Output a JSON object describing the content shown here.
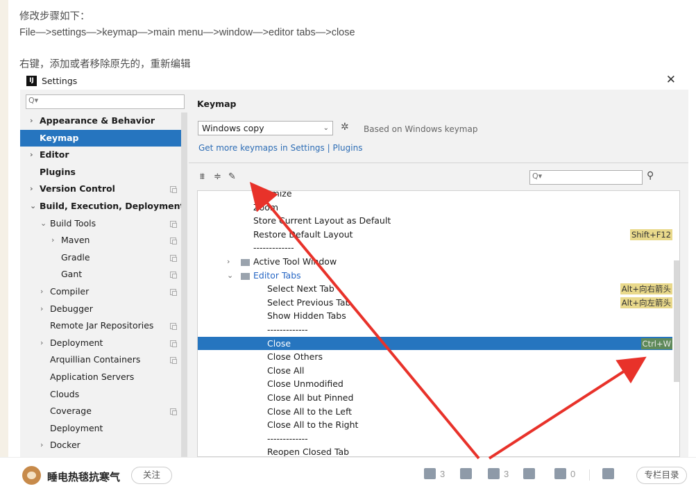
{
  "article": {
    "line1": "修改步骤如下：",
    "line2": "File—>settings—>keymap—>main menu—>window—>editor tabs—>close",
    "line3": "右键，添加或者移除原先的，重新编辑"
  },
  "dialog": {
    "title": "Settings",
    "logo_text": "IJ",
    "close_glyph": "✕"
  },
  "sidebar": {
    "search_glyph": "Q▾",
    "items": [
      {
        "label": "Appearance & Behavior",
        "indent": 0,
        "arrow": "›",
        "bold": true
      },
      {
        "label": "Keymap",
        "indent": 0,
        "arrow": "",
        "bold": true,
        "selected": true
      },
      {
        "label": "Editor",
        "indent": 0,
        "arrow": "›",
        "bold": true
      },
      {
        "label": "Plugins",
        "indent": 0,
        "arrow": "",
        "bold": true
      },
      {
        "label": "Version Control",
        "indent": 0,
        "arrow": "›",
        "bold": true,
        "copy": true
      },
      {
        "label": "Build, Execution, Deployment",
        "indent": 0,
        "arrow": "⌄",
        "bold": true
      },
      {
        "label": "Build Tools",
        "indent": 1,
        "arrow": "⌄",
        "copy": true
      },
      {
        "label": "Maven",
        "indent": 2,
        "arrow": "›",
        "copy": true
      },
      {
        "label": "Gradle",
        "indent": 2,
        "arrow": "",
        "copy": true
      },
      {
        "label": "Gant",
        "indent": 2,
        "arrow": "",
        "copy": true
      },
      {
        "label": "Compiler",
        "indent": 1,
        "arrow": "›",
        "copy": true
      },
      {
        "label": "Debugger",
        "indent": 1,
        "arrow": "›"
      },
      {
        "label": "Remote Jar Repositories",
        "indent": 1,
        "arrow": "",
        "copy": true
      },
      {
        "label": "Deployment",
        "indent": 1,
        "arrow": "›",
        "copy": true
      },
      {
        "label": "Arquillian Containers",
        "indent": 1,
        "arrow": "",
        "copy": true
      },
      {
        "label": "Application Servers",
        "indent": 1,
        "arrow": ""
      },
      {
        "label": "Clouds",
        "indent": 1,
        "arrow": ""
      },
      {
        "label": "Coverage",
        "indent": 1,
        "arrow": "",
        "copy": true
      },
      {
        "label": "Deployment",
        "indent": 1,
        "arrow": ""
      },
      {
        "label": "Docker",
        "indent": 1,
        "arrow": "›"
      }
    ]
  },
  "keymap": {
    "title": "Keymap",
    "selected_keymap": "Windows copy",
    "dropdown_caret": "⌄",
    "gear_glyph": "✲",
    "based_on": "Based on Windows keymap",
    "get_more": "Get more keymaps in Settings | Plugins",
    "expand_glyph": "⩩",
    "collapse_glyph": "≑",
    "edit_glyph": "✎",
    "search_glyph": "Q▾",
    "find_shortcut_glyph": "⚲"
  },
  "actions": [
    {
      "label": "Minimize",
      "level": 0
    },
    {
      "label": "Zoom",
      "level": 0
    },
    {
      "label": "Store Current Layout as Default",
      "level": 0
    },
    {
      "label": "Restore Default Layout",
      "level": 0,
      "shortcut": "Shift+F12"
    },
    {
      "label": "-------------",
      "level": 0
    },
    {
      "label": "Active Tool Window",
      "level": 0,
      "folder": true,
      "arrow": "›"
    },
    {
      "label": "Editor Tabs",
      "level": 0,
      "folder": true,
      "arrow": "⌄",
      "blue": true
    },
    {
      "label": "Select Next Tab",
      "level": 1,
      "shortcut": "Alt+向右箭头"
    },
    {
      "label": "Select Previous Tab",
      "level": 1,
      "shortcut": "Alt+向左箭头"
    },
    {
      "label": "Show Hidden Tabs",
      "level": 1
    },
    {
      "label": "-------------",
      "level": 1
    },
    {
      "label": "Close",
      "level": 1,
      "shortcut": "Ctrl+W",
      "selected": true
    },
    {
      "label": "Close Others",
      "level": 1
    },
    {
      "label": "Close All",
      "level": 1
    },
    {
      "label": "Close Unmodified",
      "level": 1
    },
    {
      "label": "Close All but Pinned",
      "level": 1
    },
    {
      "label": "Close All to the Left",
      "level": 1
    },
    {
      "label": "Close All to the Right",
      "level": 1
    },
    {
      "label": "-------------",
      "level": 1
    },
    {
      "label": "Reopen Closed Tab",
      "level": 1
    }
  ],
  "footer": {
    "author": "睡电热毯抗寒气",
    "follow": "关注",
    "like_count": "3",
    "favorite_count": "3",
    "comment_count": "0",
    "catalog": "专栏目录"
  },
  "colors": {
    "selection": "#2675bf",
    "shortcut_badge": "#e9d98b",
    "annotation_arrow": "#e8322a",
    "link": "#2d6db5"
  }
}
